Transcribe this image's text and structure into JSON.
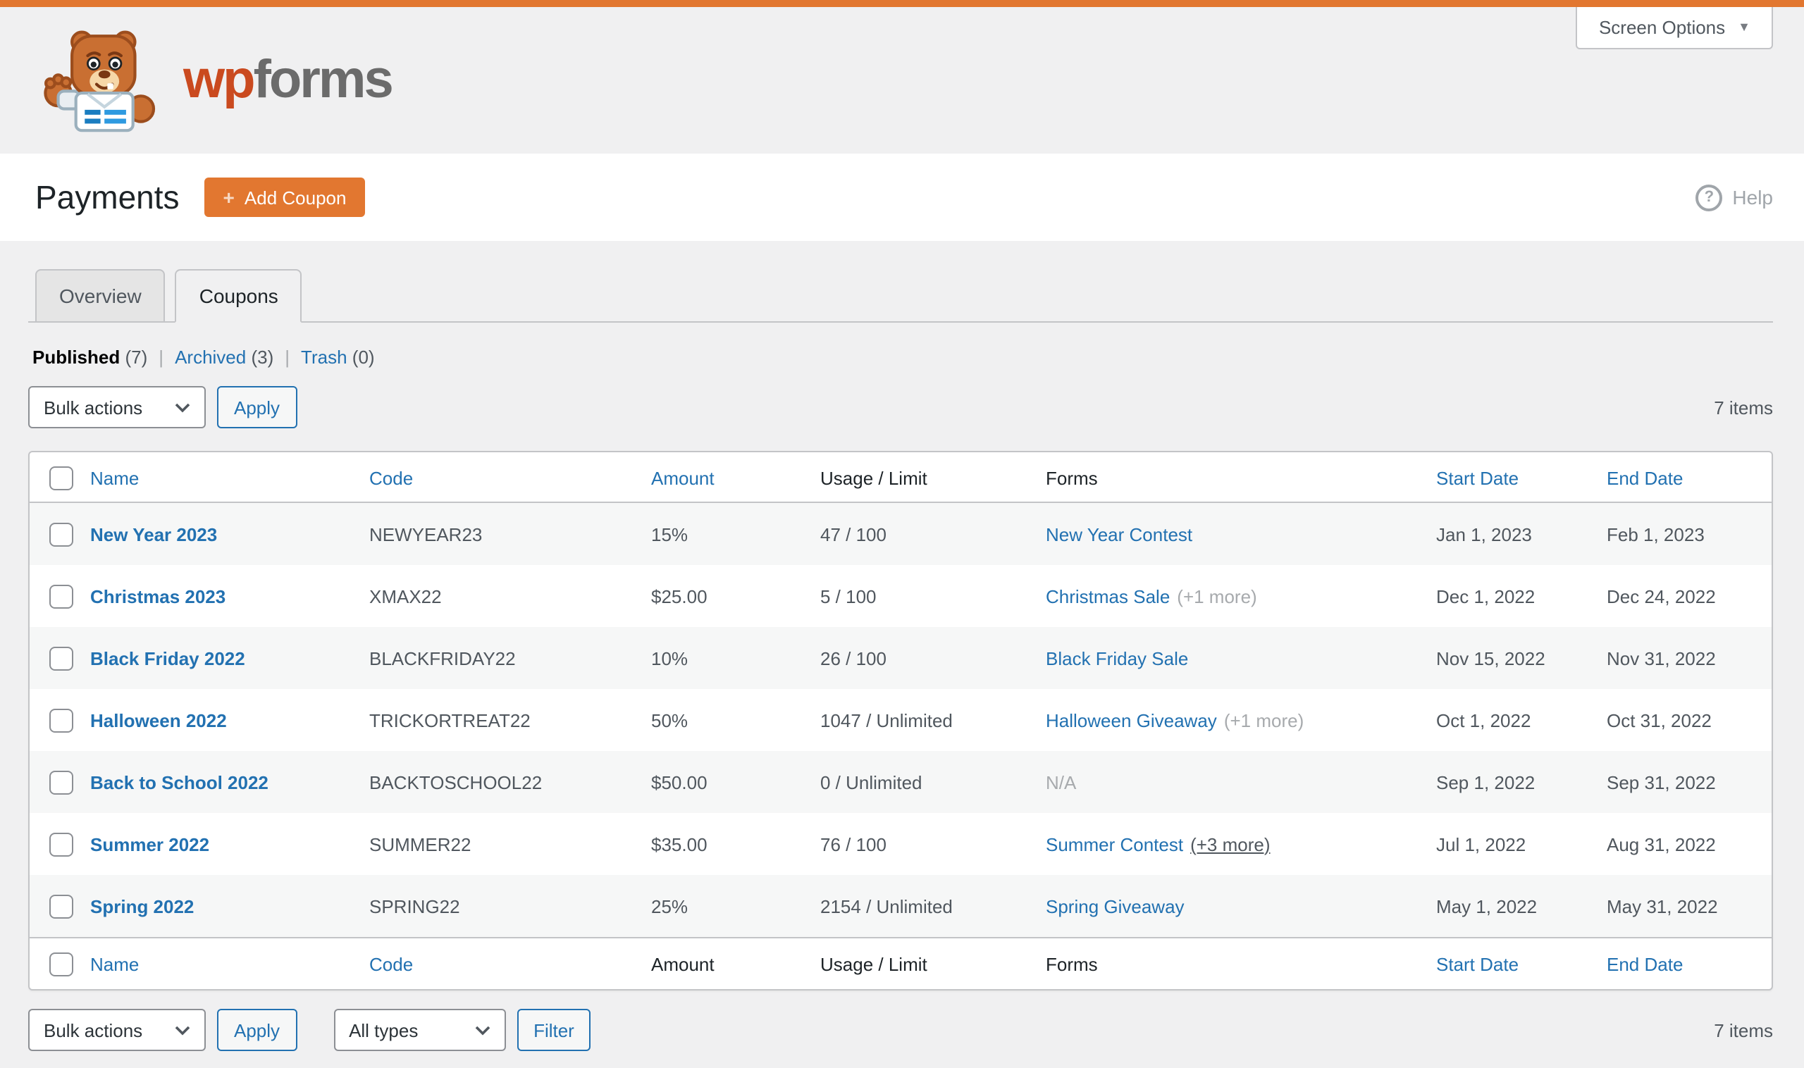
{
  "colors": {
    "brand_orange": "#e27730",
    "wordmark_orange": "#ca4a1f",
    "wordmark_gray": "#6b6b6b",
    "link_blue": "#2271b1",
    "text_dark": "#1d2327",
    "text_gray": "#50575e",
    "muted_gray": "#a7aaad",
    "stripe_gray": "#f6f7f7",
    "page_bg": "#f0f0f1",
    "border_gray": "#c3c4c7"
  },
  "icons": {
    "screen_options_caret": "▼",
    "add_coupon_plus": "+",
    "help_glyph": "?",
    "select_caret": "chevron-down",
    "logo": "wpforms-bear"
  },
  "brand": {
    "logo_text_primary": "wp",
    "logo_text_secondary": "forms"
  },
  "screen_options": {
    "label": "Screen Options"
  },
  "page_header": {
    "title": "Payments",
    "add_coupon_label": "Add Coupon",
    "help_label": "Help"
  },
  "tabs": [
    {
      "label": "Overview",
      "active": false
    },
    {
      "label": "Coupons",
      "active": true
    }
  ],
  "status_filters": [
    {
      "label": "Published",
      "count": "(7)",
      "current": true
    },
    {
      "label": "Archived",
      "count": "(3)",
      "current": false
    },
    {
      "label": "Trash",
      "count": "(0)",
      "current": false
    }
  ],
  "toolbar_top": {
    "bulk_actions_value": "Bulk actions",
    "apply_label": "Apply",
    "items_count": "7 items"
  },
  "toolbar_bottom": {
    "bulk_actions_value": "Bulk actions",
    "apply_label": "Apply",
    "type_filter_value": "All types",
    "filter_label": "Filter",
    "items_count": "7 items"
  },
  "table": {
    "header_cells": [
      {
        "type": "checkbox"
      },
      {
        "label": "Name",
        "link": true
      },
      {
        "label": "Code",
        "link": true
      },
      {
        "label": "Amount",
        "link": true
      },
      {
        "label": "Usage / Limit",
        "link": false
      },
      {
        "label": "Forms",
        "link": false
      },
      {
        "label": "Start Date",
        "link": true
      },
      {
        "label": "End Date",
        "link": true
      }
    ],
    "footer_cells": [
      {
        "type": "checkbox"
      },
      {
        "label": "Name",
        "link": true
      },
      {
        "label": "Code",
        "link": true
      },
      {
        "label": "Amount",
        "link": false
      },
      {
        "label": "Usage / Limit",
        "link": false
      },
      {
        "label": "Forms",
        "link": false
      },
      {
        "label": "Start Date",
        "link": true
      },
      {
        "label": "End Date",
        "link": true
      }
    ],
    "rows": [
      {
        "name": "New Year 2023",
        "code": "NEWYEAR23",
        "amount": "15%",
        "usage": "47 / 100",
        "form_link": "New Year Contest",
        "form_note": "",
        "form_note_style": "",
        "start": "Jan 1, 2023",
        "end": "Feb 1, 2023"
      },
      {
        "name": "Christmas 2023",
        "code": "XMAX22",
        "amount": "$25.00",
        "usage": "5 / 100",
        "form_link": "Christmas Sale",
        "form_note": "(+1 more)",
        "form_note_style": "muted",
        "start": "Dec 1, 2022",
        "end": "Dec 24, 2022"
      },
      {
        "name": "Black Friday 2022",
        "code": "BLACKFRIDAY22",
        "amount": "10%",
        "usage": "26 / 100",
        "form_link": "Black Friday Sale",
        "form_note": "",
        "form_note_style": "",
        "start": "Nov 15, 2022",
        "end": "Nov 31, 2022"
      },
      {
        "name": "Halloween 2022",
        "code": "TRICKORTREAT22",
        "amount": "50%",
        "usage": "1047 / Unlimited",
        "form_link": "Halloween Giveaway",
        "form_note": "(+1 more)",
        "form_note_style": "muted",
        "start": "Oct 1, 2022",
        "end": "Oct 31, 2022"
      },
      {
        "name": "Back to School 2022",
        "code": "BACKTOSCHOOL22",
        "amount": "$50.00",
        "usage": "0 / Unlimited",
        "form_link": "",
        "form_note": "N/A",
        "form_note_style": "muted",
        "start": "Sep 1, 2022",
        "end": "Sep 31, 2022"
      },
      {
        "name": "Summer 2022",
        "code": "SUMMER22",
        "amount": "$35.00",
        "usage": "76 / 100",
        "form_link": "Summer Contest",
        "form_note": "(+3 more)",
        "form_note_style": "toggle",
        "start": "Jul 1, 2022",
        "end": "Aug 31, 2022"
      },
      {
        "name": "Spring 2022",
        "code": "SPRING22",
        "amount": "25%",
        "usage": "2154 / Unlimited",
        "form_link": "Spring Giveaway",
        "form_note": "",
        "form_note_style": "",
        "start": "May 1, 2022",
        "end": "May 31, 2022"
      }
    ]
  }
}
